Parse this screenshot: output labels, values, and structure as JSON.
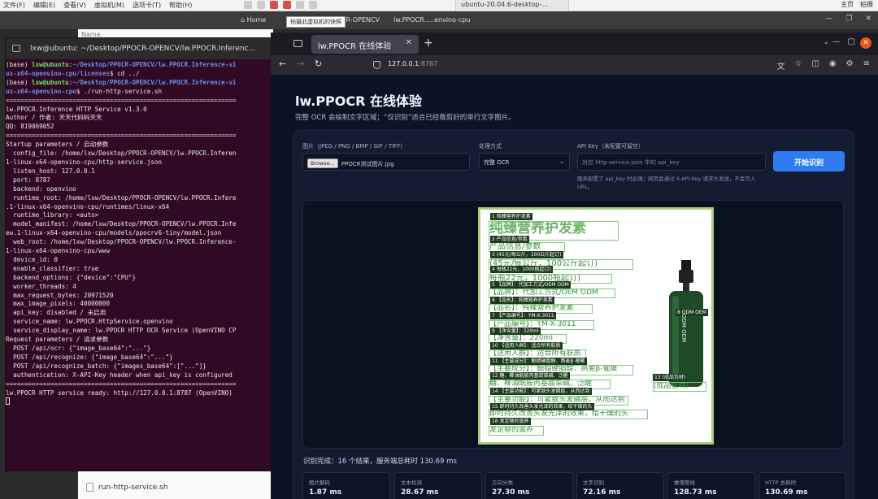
{
  "host_topbar": {
    "menu": [
      "文件(F)",
      "编辑(E)",
      "查看(V)",
      "虚拟机(M)",
      "选项卡(T)",
      "帮助(H)"
    ],
    "tab_title": "ubuntu-20.04.6-desktop-...",
    "right_items": [
      "主页",
      "拍摄"
    ]
  },
  "vm_tabs": {
    "items": [
      "Home",
      "PPOCR-OPENCV",
      "lw.PPOCR.....envino-cpu"
    ],
    "tooltip": "拍摄此虚拟机的快照"
  },
  "terminal": {
    "title": "lxw@ubuntu: ~/Desktop/PPOCR-OPENCV/lw.PPOCR.Inferenc...",
    "lines": [
      {
        "parts": [
          {
            "t": "(base) "
          },
          {
            "t": "lxw@ubuntu",
            "c": "g"
          },
          {
            "t": ":"
          },
          {
            "t": "~/Desktop/PPOCR-OPENCV/lw.PPOCR.Inference-vi",
            "c": "b"
          }
        ]
      },
      {
        "parts": [
          {
            "t": "ux-x64-openvino-cpu/licenses",
            "c": "b"
          },
          {
            "t": "$ cd ../"
          }
        ]
      },
      {
        "parts": [
          {
            "t": "(base) "
          },
          {
            "t": "lxw@ubuntu",
            "c": "g"
          },
          {
            "t": ":"
          },
          {
            "t": "~/Desktop/PPOCR-OPENCV/lw.PPOCR.Inference-vi",
            "c": "b"
          }
        ]
      },
      {
        "parts": [
          {
            "t": "ux-x64-openvino-cpu",
            "c": "b"
          },
          {
            "t": "$ ./run-http-service.sh"
          }
        ]
      },
      {
        "parts": [
          {
            "t": "=============================================================="
          }
        ]
      },
      {
        "parts": [
          {
            "t": "lw.PPOCR.Inference HTTP Service v1.3.0"
          }
        ]
      },
      {
        "parts": [
          {
            "t": "Author / 作者: 天天代码码天天"
          }
        ]
      },
      {
        "parts": [
          {
            "t": "QQ: 819069052"
          }
        ]
      },
      {
        "parts": [
          {
            "t": "=============================================================="
          }
        ]
      },
      {
        "parts": [
          {
            "t": "Startup parameters / 启动参数"
          }
        ]
      },
      {
        "parts": [
          {
            "t": "  config_file: /home/lxw/Desktop/PPOCR-OPENCV/lw.PPOCR.Inferen"
          }
        ]
      },
      {
        "parts": [
          {
            "t": "1-linux-x64-openvino-cpu/http-service.json"
          }
        ]
      },
      {
        "parts": [
          {
            "t": "  listen_host: 127.0.0.1"
          }
        ]
      },
      {
        "parts": [
          {
            "t": "  port: 8787"
          }
        ]
      },
      {
        "parts": [
          {
            "t": "  backend: openvino"
          }
        ]
      },
      {
        "parts": [
          {
            "t": "  runtime_root: /home/lxw/Desktop/PPOCR-OPENCV/lw.PPOCR.Infere"
          }
        ]
      },
      {
        "parts": [
          {
            "t": ".1-linux-x64-openvino-cpu/runtimes/linux-x64"
          }
        ]
      },
      {
        "parts": [
          {
            "t": "  runtime_library: <auto>"
          }
        ]
      },
      {
        "parts": [
          {
            "t": "  model_manifest: /home/lxw/Desktop/PPOCR-OPENCV/lw.PPOCR.Infe"
          }
        ]
      },
      {
        "parts": [
          {
            "t": "ew.1-linux-x64-openvino-cpu/models/ppocrv6-tiny/model.json"
          }
        ]
      },
      {
        "parts": [
          {
            "t": "  web_root: /home/lxw/Desktop/PPOCR-OPENCV/lw.PPOCR.Inference-"
          }
        ]
      },
      {
        "parts": [
          {
            "t": "1-linux-x64-openvino-cpu/www"
          }
        ]
      },
      {
        "parts": [
          {
            "t": "  device_id: 0"
          }
        ]
      },
      {
        "parts": [
          {
            "t": "  enable_classifier: true"
          }
        ]
      },
      {
        "parts": [
          {
            "t": "  backend_options: {\"device\":\"CPU\"}"
          }
        ]
      },
      {
        "parts": [
          {
            "t": "  worker_threads: 4"
          }
        ]
      },
      {
        "parts": [
          {
            "t": "  max_request_bytes: 20971520"
          }
        ]
      },
      {
        "parts": [
          {
            "t": "  max_image_pixels: 40000000"
          }
        ]
      },
      {
        "parts": [
          {
            "t": "  api_key: disabled / 未启用"
          }
        ]
      },
      {
        "parts": [
          {
            "t": "  service_name: lw.PPOCR.HttpService.openvino"
          }
        ]
      },
      {
        "parts": [
          {
            "t": "  service_display_name: lw.PPOCR HTTP OCR Service (OpenVINO CP"
          }
        ]
      },
      {
        "parts": [
          {
            "t": "Request parameters / 请求参数"
          }
        ]
      },
      {
        "parts": [
          {
            "t": "  POST /api/ocr: {\"image_base64\":\"...\"}"
          }
        ]
      },
      {
        "parts": [
          {
            "t": "  POST /api/recognize: {\"image_base64\":\"...\"}"
          }
        ]
      },
      {
        "parts": [
          {
            "t": "  POST /api/recognize_batch: {\"images_base64\":[\"...\"]}"
          }
        ]
      },
      {
        "parts": [
          {
            "t": "  authentication: X-API-Key header when api_key is configured"
          }
        ]
      },
      {
        "parts": [
          {
            "t": "=============================================================="
          }
        ]
      },
      {
        "parts": [
          {
            "t": "lw.PPOCR HTTP service ready: http://127.0.0.1:8787 (OpenVINO)"
          }
        ]
      }
    ]
  },
  "file_manager": {
    "column": "Name",
    "file": "run-http-service.sh"
  },
  "browser": {
    "tab_title": "lw.PPOCR 在线体验",
    "url_host": "127.0.0.1",
    "url_port": ":8787"
  },
  "page": {
    "title": "lw.PPOCR 在线体验",
    "subtitle": "完整 OCR 会绘制文字区域；“仅识别”适合已经裁剪好的单行文字图片。",
    "image_label": "图片（JPEG / PNG / BMP / GIF / TIFF）",
    "browse_label": "Browse...",
    "file_name": "PPOCR测试图片.jpg",
    "mode_label": "处理方式",
    "mode_value": "完整 OCR",
    "apikey_label": "API Key（未配置可留空）",
    "apikey_placeholder": "对应 http-service.json 中的 api_key",
    "apikey_help": "服务配置了 api_key 时必填；网页会通过 X-API-Key 请求头发送，不会写入 URL。",
    "start_button": "开始识别",
    "result_summary": "识别完成：16 个结果，服务端总耗时 130.69 ms",
    "metrics": [
      {
        "label": "图片解码",
        "value": "1.87 ms"
      },
      {
        "label": "文本检测",
        "value": "28.67 ms"
      },
      {
        "label": "方向分类",
        "value": "27.30 ms"
      },
      {
        "label": "文字识别",
        "value": "72.16 ms"
      },
      {
        "label": "推理管线",
        "value": "128.73 ms"
      },
      {
        "label": "HTTP 总耗时",
        "value": "130.69 ms"
      }
    ]
  },
  "ocr_results": [
    {
      "tag": "1 纯臻营养护发素",
      "text": "纯臻营养护发素"
    },
    {
      "tag": "2 产品信息/参数",
      "text": "产品信息/参数"
    },
    {
      "tag": "3 (45元/每公斤，100公斤起订)",
      "text": "(45元/每公斤，100公斤起订)"
    },
    {
      "tag": "4 每瓶22元，1000瓶起订)",
      "text": "每瓶22元，1000瓶起订)"
    },
    {
      "tag": "5 【品牌】：代加工方式/OEM ODM",
      "text": "【品牌】：代加工方式/OEM ODM"
    },
    {
      "tag": "6 【品名】：纯臻营养护发素",
      "text": "【品名】：纯臻营养护发素"
    },
    {
      "tag": "7 【产品编号】：YM-X-3011",
      "text": "【产品编号】：YM-X-3011"
    },
    {
      "tag": "8 ODM OEM",
      "text": "ODM OEM"
    },
    {
      "tag": "9 【净含量】：220ml",
      "text": "【净含量】：220ml"
    },
    {
      "tag": "10 【适用人群】：适合所有肤质",
      "text": "【适用人群】：适合所有肤质"
    },
    {
      "tag": "11 【主要成分】：鲸蜡硬脂醇、燕麦β-葡聚",
      "text": "【主要成分】：鲸蜡硬脂醇、燕麦β-葡聚"
    },
    {
      "tag": "12 糖、椰油酰胺丙基甜菜碱、泛醒",
      "text": "糖、椰油酰胺丙基甜菜碱、泛醒"
    },
    {
      "tag": "13 (成品包材)",
      "text": "(成品包材)"
    },
    {
      "tag": "14 【主要功能】：可紧致头发磷层，从而达到",
      "text": "【主要功能】：可紧致头发磷层，从而达到"
    },
    {
      "tag": "15 即时持久改善头发光泽的效果，给干燥的头",
      "text": "即时持久改善头发光泽的效果，给干燥的头"
    },
    {
      "tag": "16 发足够的滋养",
      "text": "发足够的滋养"
    }
  ]
}
